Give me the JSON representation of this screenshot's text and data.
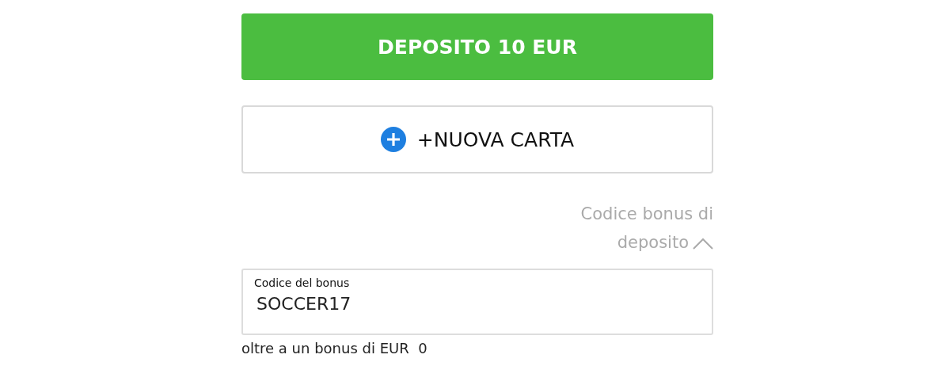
{
  "deposit_button": {
    "label": "DEPOSITO 10 EUR"
  },
  "new_card_button": {
    "label": "+NUOVA CARTA"
  },
  "bonus_toggle": {
    "label": "Codice bonus di deposito",
    "expanded": true
  },
  "bonus_field": {
    "label": "Codice del bonus",
    "value": "SOCCER17"
  },
  "bonus_note": "oltre a un bonus di EUR  0"
}
